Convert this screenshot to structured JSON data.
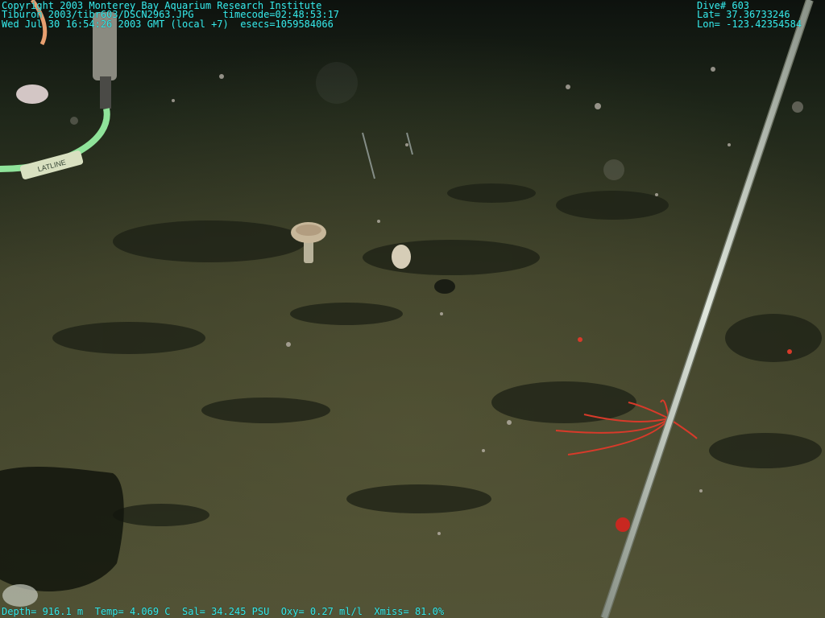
{
  "overlay": {
    "top_left": [
      "Copyright 2003 Monterey Bay Aquarium Research Institute",
      "Tiburon 2003/tibr603/DSCN2963.JPG     timecode=02:48:53:17",
      "Wed Jul 30 16:54:26 2003 GMT (local +7)  esecs=1059584066"
    ],
    "top_right": [
      "Dive# 603",
      "Lat= 37.36733246",
      "Lon= -123.42354584"
    ],
    "bottom": "Depth= 916.1 m  Temp= 4.069 C  Sal= 34.245 PSU  Oxy= 0.27 ml/l  Xmiss= 81.0%"
  },
  "cable_label": "LATLINE",
  "colors": {
    "overlay_text": "#38e8e8",
    "seafloor": "#4a4d32",
    "water": "#10150f",
    "pipe": "#b8c0b0",
    "coral": "#d83a2a"
  }
}
